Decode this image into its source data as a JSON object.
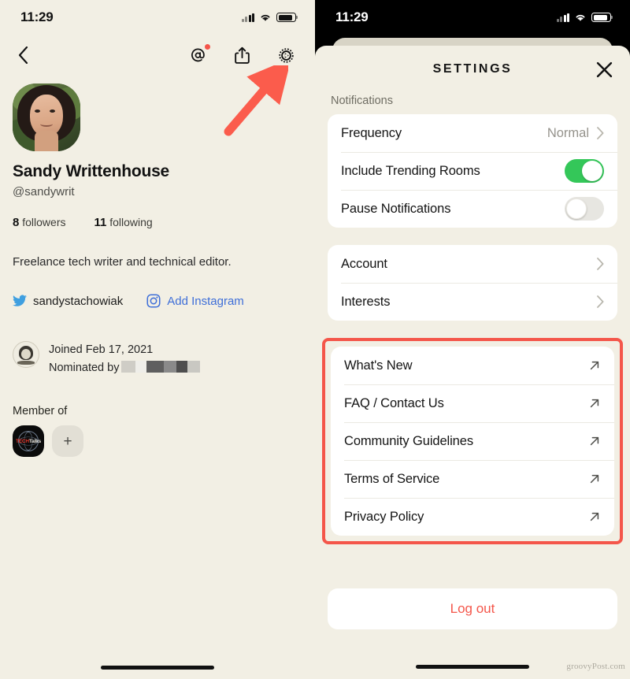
{
  "colors": {
    "app_background": "#F2EFE4",
    "card_white": "#FFFFFF",
    "accent_red": "#F4564A",
    "toggle_on_green": "#34C759",
    "link_blue": "#3F6FD8",
    "muted_text": "#6F6D63"
  },
  "left_phone": {
    "status_bar": {
      "time": "11:29",
      "signal_icon": "cellular-signal-icon",
      "wifi_icon": "wifi-icon",
      "battery_icon": "battery-icon"
    },
    "nav_bar": {
      "back_icon": "chevron-left-icon",
      "mentions_icon": "at-mention-icon",
      "mentions_badge": "unread-dot",
      "share_icon": "share-icon",
      "settings_icon": "gear-icon"
    },
    "profile": {
      "avatar": "user-avatar-photo",
      "name": "Sandy Writtenhouse",
      "handle": "@sandywrit",
      "stats": [
        {
          "count": "8",
          "label": "followers"
        },
        {
          "count": "11",
          "label": "following"
        }
      ],
      "bio": "Freelance tech writer and technical editor.",
      "socials": [
        {
          "icon": "twitter-icon",
          "label": "sandystachowiak",
          "style": "dark"
        },
        {
          "icon": "instagram-icon",
          "label": "Add Instagram",
          "style": "link"
        }
      ],
      "joined": "Joined Feb 17, 2021",
      "nominated_by_prefix": "Nominated by",
      "nominated_by_value": "",
      "member_of_label": "Member of",
      "clubs": [
        {
          "name_part_1": "TECH",
          "name_part_2": "Talks",
          "icon": "club-avatar"
        }
      ],
      "add_club_label": "+"
    }
  },
  "right_phone": {
    "status_bar": {
      "time": "11:29",
      "signal_icon": "cellular-signal-icon",
      "wifi_icon": "wifi-icon",
      "battery_icon": "battery-icon"
    },
    "settings": {
      "title": "SETTINGS",
      "close_icon": "close-icon",
      "notifications_label": "Notifications",
      "notification_rows": [
        {
          "label": "Frequency",
          "value": "Normal",
          "control": "chevron"
        },
        {
          "label": "Include Trending Rooms",
          "value": "",
          "control": "toggle-on"
        },
        {
          "label": "Pause Notifications",
          "value": "",
          "control": "toggle-off"
        }
      ],
      "account_rows": [
        {
          "label": "Account",
          "control": "chevron"
        },
        {
          "label": "Interests",
          "control": "chevron"
        }
      ],
      "info_rows": [
        {
          "label": "What's New",
          "control": "external"
        },
        {
          "label": "FAQ / Contact Us",
          "control": "external"
        },
        {
          "label": "Community Guidelines",
          "control": "external"
        },
        {
          "label": "Terms of Service",
          "control": "external"
        },
        {
          "label": "Privacy Policy",
          "control": "external"
        }
      ],
      "logout_label": "Log out"
    }
  },
  "annotations": {
    "arrow": "red-arrow-pointing-to-gear-icon",
    "highlight": "red-box-around-info-links"
  },
  "watermark": "groovyPost.com"
}
